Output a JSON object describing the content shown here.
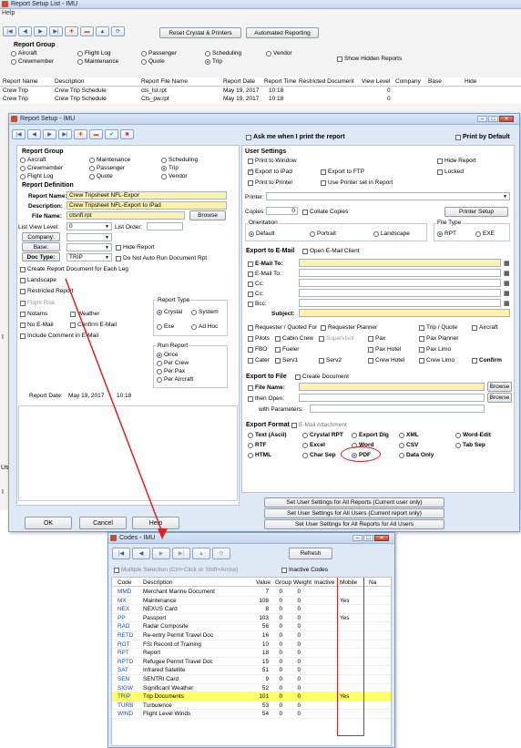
{
  "back_window": {
    "title": "Report Setup List - IMU",
    "menu": "Help",
    "buttons": {
      "reset": "Reset Crystal & Printers",
      "automated": "Automated Reporting"
    },
    "report_group": {
      "label": "Report Group",
      "options": [
        "Aircraft",
        "Flight Log",
        "Passenger",
        "Scheduling",
        "Vendor",
        "Crewmember",
        "Maintenance",
        "Quote",
        "Trip"
      ],
      "selected": "Trip"
    },
    "show_hidden": "Show Hidden Reports",
    "columns": [
      "Report Name",
      "Description",
      "Report File Name",
      "Report Date",
      "Report Time",
      "Restricted Document",
      "View Level",
      "Company",
      "Base",
      "Hide"
    ],
    "rows": [
      [
        "Crew Trip",
        "Crew Trip Schedule",
        "cts_lst.rpt",
        "May 19, 2017",
        "10:18",
        "",
        "0",
        "",
        "",
        ""
      ],
      [
        "Crew Trip",
        "Crew Trip Schedule",
        "Cts_pw.rpt",
        "May 19, 2017",
        "10:18",
        "",
        "0",
        "",
        "",
        ""
      ]
    ],
    "side_letters": [
      "I",
      "Us",
      "I"
    ]
  },
  "setup_window": {
    "title": "Report Setup - IMU",
    "ask_me": "Ask me when I print the report",
    "print_default": "Print by Default",
    "report_group": {
      "label": "Report Group",
      "options": [
        "Aircraft",
        "Maintenance",
        "Scheduling",
        "Crewmember",
        "Passenger",
        "Trip",
        "Flight Log",
        "Quote",
        "Vendor"
      ],
      "selected": "Trip"
    },
    "definition": {
      "label": "Report Definition",
      "report_name_label": "Report Name:",
      "report_name": "Crew Tripsheet NFL-Expor",
      "description_label": "Description:",
      "description": "Crew Tripsheet NFL-Export to iPad",
      "file_name_label": "File Name:",
      "file_name": "ctsnfl.rpt",
      "browse": "Browse",
      "list_view_label": "List View Level:",
      "list_view": "0",
      "list_order_label": "List Order:",
      "company_btn": "Company:",
      "base_btn": "Base:",
      "doc_type_btn": "Doc Type:",
      "doc_type": "TRIP",
      "hide_report": "Hide Report",
      "do_not_auto": "Do Not Auto Run Document Rpt",
      "create_each_leg": "Create Report Document for Each Leg",
      "checks": [
        "Landscape",
        "Restricted Report",
        "Flight Risk",
        "Notams",
        "Weather",
        "No E-Mail",
        "Confirm E-Mail",
        "Include Comment in E-Mail"
      ],
      "report_type_label": "Report Type",
      "report_type": [
        "Crystal",
        "System",
        "Exe",
        "Ad Hoc"
      ],
      "run_report_label": "Run Report",
      "run_report": [
        "Once",
        "Per Crew",
        "Per Pax",
        "Per Aircraft"
      ],
      "report_date_label": "Report Date:",
      "report_date": "May 19, 2017",
      "report_time": "10:18"
    },
    "user_settings": {
      "label": "User Settings",
      "print_to_window": "Print to Window",
      "hide_report": "Hide Report",
      "export_ipad": "Export to iPad",
      "export_ftp": "Export to FTP",
      "locked": "Locked",
      "print_to_printer": "Print to Printer",
      "use_printer_set": "Use Printer set in Report",
      "printer_label": "Printer:",
      "copies_label": "Copies:",
      "copies": "0",
      "collate": "Collate Copies",
      "printer_setup": "Printer Setup",
      "orientation_label": "Orientation",
      "orientation": [
        "Default",
        "Portrait",
        "Landscape"
      ],
      "file_type_label": "File Type",
      "file_type": [
        "RPT",
        "EXE"
      ]
    },
    "email": {
      "label": "Export to E-Mail",
      "open_client": "Open E-Mail Client",
      "fields": [
        "E-Mail To:",
        "E-Mail To:",
        "Cc:",
        "Cc:",
        "Bcc:"
      ],
      "subject": "Subject:",
      "recipients": [
        [
          "Requester / Quoted For",
          "Requester Planner",
          "Trip / Quote",
          "Aircraft"
        ],
        [
          "Pilots",
          "Cabin Crew",
          "Supervisor",
          "Pax",
          "Pax Planner"
        ],
        [
          "FBO",
          "Fueler",
          "Pax Hotel",
          "Pax Limo"
        ],
        [
          "Cater",
          "Serv1",
          "Serv2",
          "Crew Hotel",
          "Crew Limo",
          "Confirm"
        ]
      ]
    },
    "export_file": {
      "label": "Export to File",
      "create_document": "Create Document",
      "file_name": "File Name:",
      "then_open": "then Open:",
      "with_params": "with Parameters:",
      "browse": "Browse"
    },
    "export_format": {
      "label": "Export Format",
      "email_attachment": "E-Mail Attachment",
      "options": [
        "Text (Ascii)",
        "Crystal RPT",
        "Export Dlg",
        "XML",
        "Word-Edit",
        "RTF",
        "Excel",
        "Word",
        "CSV",
        "Tab Sep",
        "HTML",
        "Char Sep",
        "PDF",
        "Data Only"
      ],
      "selected": "PDF"
    },
    "set_buttons": [
      "Set User Settings for All Reports (Current user only)",
      "Set User Settings for All Users (Current report only)",
      "Set User Settings for All Reports for All Users"
    ],
    "ok": "OK",
    "cancel": "Cancel",
    "help": "Help"
  },
  "codes_window": {
    "title": "Codes - IMU",
    "refresh": "Refresh",
    "multiple_selection": "Multiple Selection (Ctrl+Click or Shift+Arrow)",
    "inactive_codes": "Inactive Codes",
    "columns": [
      "Code",
      "Description",
      "Value",
      "Group",
      "Weight",
      "Inactive",
      "Mobile",
      "Na"
    ],
    "rows": [
      [
        "MMD",
        "Merchant Marine Document",
        "7",
        "0",
        "0",
        "",
        ""
      ],
      [
        "MX",
        "Maintenance",
        "108",
        "0",
        "0",
        "",
        "Yes"
      ],
      [
        "NEX",
        "NEXUS Card",
        "8",
        "0",
        "0",
        "",
        ""
      ],
      [
        "PP",
        "Passport",
        "103",
        "0",
        "0",
        "",
        "Yes"
      ],
      [
        "RAD",
        "Radar Composite",
        "56",
        "0",
        "0",
        "",
        ""
      ],
      [
        "RETD",
        "Re-entry Permit Travel Doc",
        "16",
        "0",
        "0",
        "",
        ""
      ],
      [
        "ROT",
        "FSI Record of Training",
        "10",
        "0",
        "0",
        "",
        ""
      ],
      [
        "RPT",
        "Report",
        "18",
        "0",
        "0",
        "",
        ""
      ],
      [
        "RPTD",
        "Refugee Permit Travel Doc",
        "15",
        "0",
        "0",
        "",
        ""
      ],
      [
        "SAT",
        "Infrared Satellite",
        "51",
        "0",
        "0",
        "",
        ""
      ],
      [
        "SEN",
        "SENTRI Card",
        "9",
        "0",
        "0",
        "",
        ""
      ],
      [
        "SIGW",
        "Significant Weather",
        "52",
        "0",
        "0",
        "",
        ""
      ],
      [
        "TRIP",
        "Trip Documents",
        "101",
        "0",
        "0",
        "",
        "Yes"
      ],
      [
        "TURB",
        "Turbulence",
        "53",
        "0",
        "0",
        "",
        ""
      ],
      [
        "WIND",
        "Flight Level Winds",
        "54",
        "0",
        "0",
        "",
        ""
      ]
    ],
    "selected_code": "TRIP"
  },
  "colors": {
    "highlight": "#ffff66",
    "annotation": "#e02020",
    "field_yellow": "#fdf1b0"
  }
}
